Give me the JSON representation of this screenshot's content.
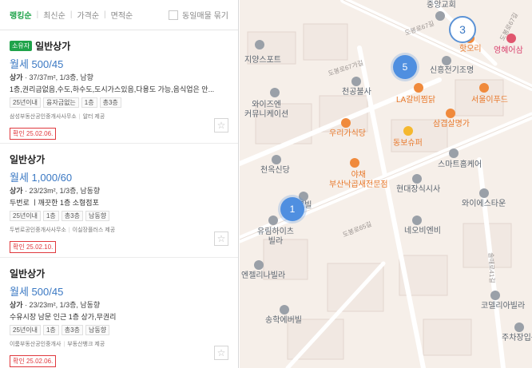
{
  "sort": {
    "options": [
      "랭킹순",
      "최신순",
      "가격순",
      "면적순"
    ],
    "toggle_label": "동일매물 묶기"
  },
  "listings": [
    {
      "badge": "소유자",
      "title": "일반상가",
      "price": "월세 500/45",
      "specs_type": "상가",
      "specs": " · 37/37m², 1/3층, 남향",
      "desc": "1층,권리금없음,수도,하수도,도시가스있음,다용도 가능,음식업은 안...",
      "tags": [
        "25년이내",
        "융자금없는",
        "1층",
        "총3층"
      ],
      "agency": [
        "삼성부동산공인중개사사무소",
        "알터 제공"
      ],
      "confirm": "확인 25.02.06."
    },
    {
      "badge": "",
      "title": "일반상가",
      "price": "월세 1,000/60",
      "specs_type": "상가",
      "specs": " · 23/23m², 1/3층, 남동향",
      "desc": "두번로 ㅣ깨끗한 1층 소형점포",
      "tags": [
        "25년이내",
        "1층",
        "총3층",
        "남동향"
      ],
      "agency": [
        "두번로공인중개사사무소",
        "이실장플러스 제공"
      ],
      "confirm": "확인 25.02.10."
    },
    {
      "badge": "",
      "title": "일반상가",
      "price": "월세 500/45",
      "specs_type": "상가",
      "specs": " · 23/23m², 1/3층, 남동향",
      "desc": "수유시장 남문 인근 1층 상가,무권리",
      "tags": [
        "25년이내",
        "1층",
        "총3층",
        "남동향"
      ],
      "agency": [
        "이룸부동산공인중개사",
        "부동산뱅크 제공"
      ],
      "confirm": "확인 25.02.06."
    }
  ],
  "map": {
    "pois": [
      {
        "name": "중앙교회",
        "color": "gray"
      },
      {
        "name": "지양스포트",
        "color": "gray"
      },
      {
        "name": "핫오리",
        "color": "orange"
      },
      {
        "name": "영혜어삼",
        "color": "pink"
      },
      {
        "name": "신흥전기조명",
        "color": "gray"
      },
      {
        "name": "천공불사",
        "color": "gray"
      },
      {
        "name": "LA갈비찜닭",
        "color": "orange"
      },
      {
        "name": "서울이푸드",
        "color": "orange"
      },
      {
        "name": "와이즈엔\n커뮤니케이션",
        "color": "gray"
      },
      {
        "name": "우리가식당",
        "color": "orange"
      },
      {
        "name": "삼겹살명가",
        "color": "orange"
      },
      {
        "name": "동보슈퍼",
        "color": "orange"
      },
      {
        "name": "천옥신당",
        "color": "gray"
      },
      {
        "name": "스마트홈케어",
        "color": "gray"
      },
      {
        "name": "야채\n부산낙곱새전문점",
        "color": "orange"
      },
      {
        "name": "현대장식시사",
        "color": "gray"
      },
      {
        "name": "와이에스타운",
        "color": "gray"
      },
      {
        "name": "르빌",
        "color": "gray"
      },
      {
        "name": "유림하이츠\n빌라",
        "color": "gray"
      },
      {
        "name": "네오비엔비",
        "color": "gray"
      },
      {
        "name": "엔젤리나빌라",
        "color": "gray"
      },
      {
        "name": "송학에버빌",
        "color": "gray"
      },
      {
        "name": "코델리아빌라",
        "color": "gray"
      },
      {
        "name": "주차장입구",
        "color": "gray"
      }
    ],
    "roads": [
      "도봉로67길",
      "도봉로67가길",
      "도봉로65길",
      "솔매로41길",
      "도봉로67길"
    ],
    "clusters": [
      {
        "count": "5",
        "style": "solid"
      },
      {
        "count": "3",
        "style": "outline"
      },
      {
        "count": "1",
        "style": "solid"
      }
    ]
  },
  "colors": {
    "accent_green": "#1fa34a",
    "price_blue": "#3a78c3",
    "confirm_red": "#e0393e",
    "map_bg": "#f6efe9"
  }
}
